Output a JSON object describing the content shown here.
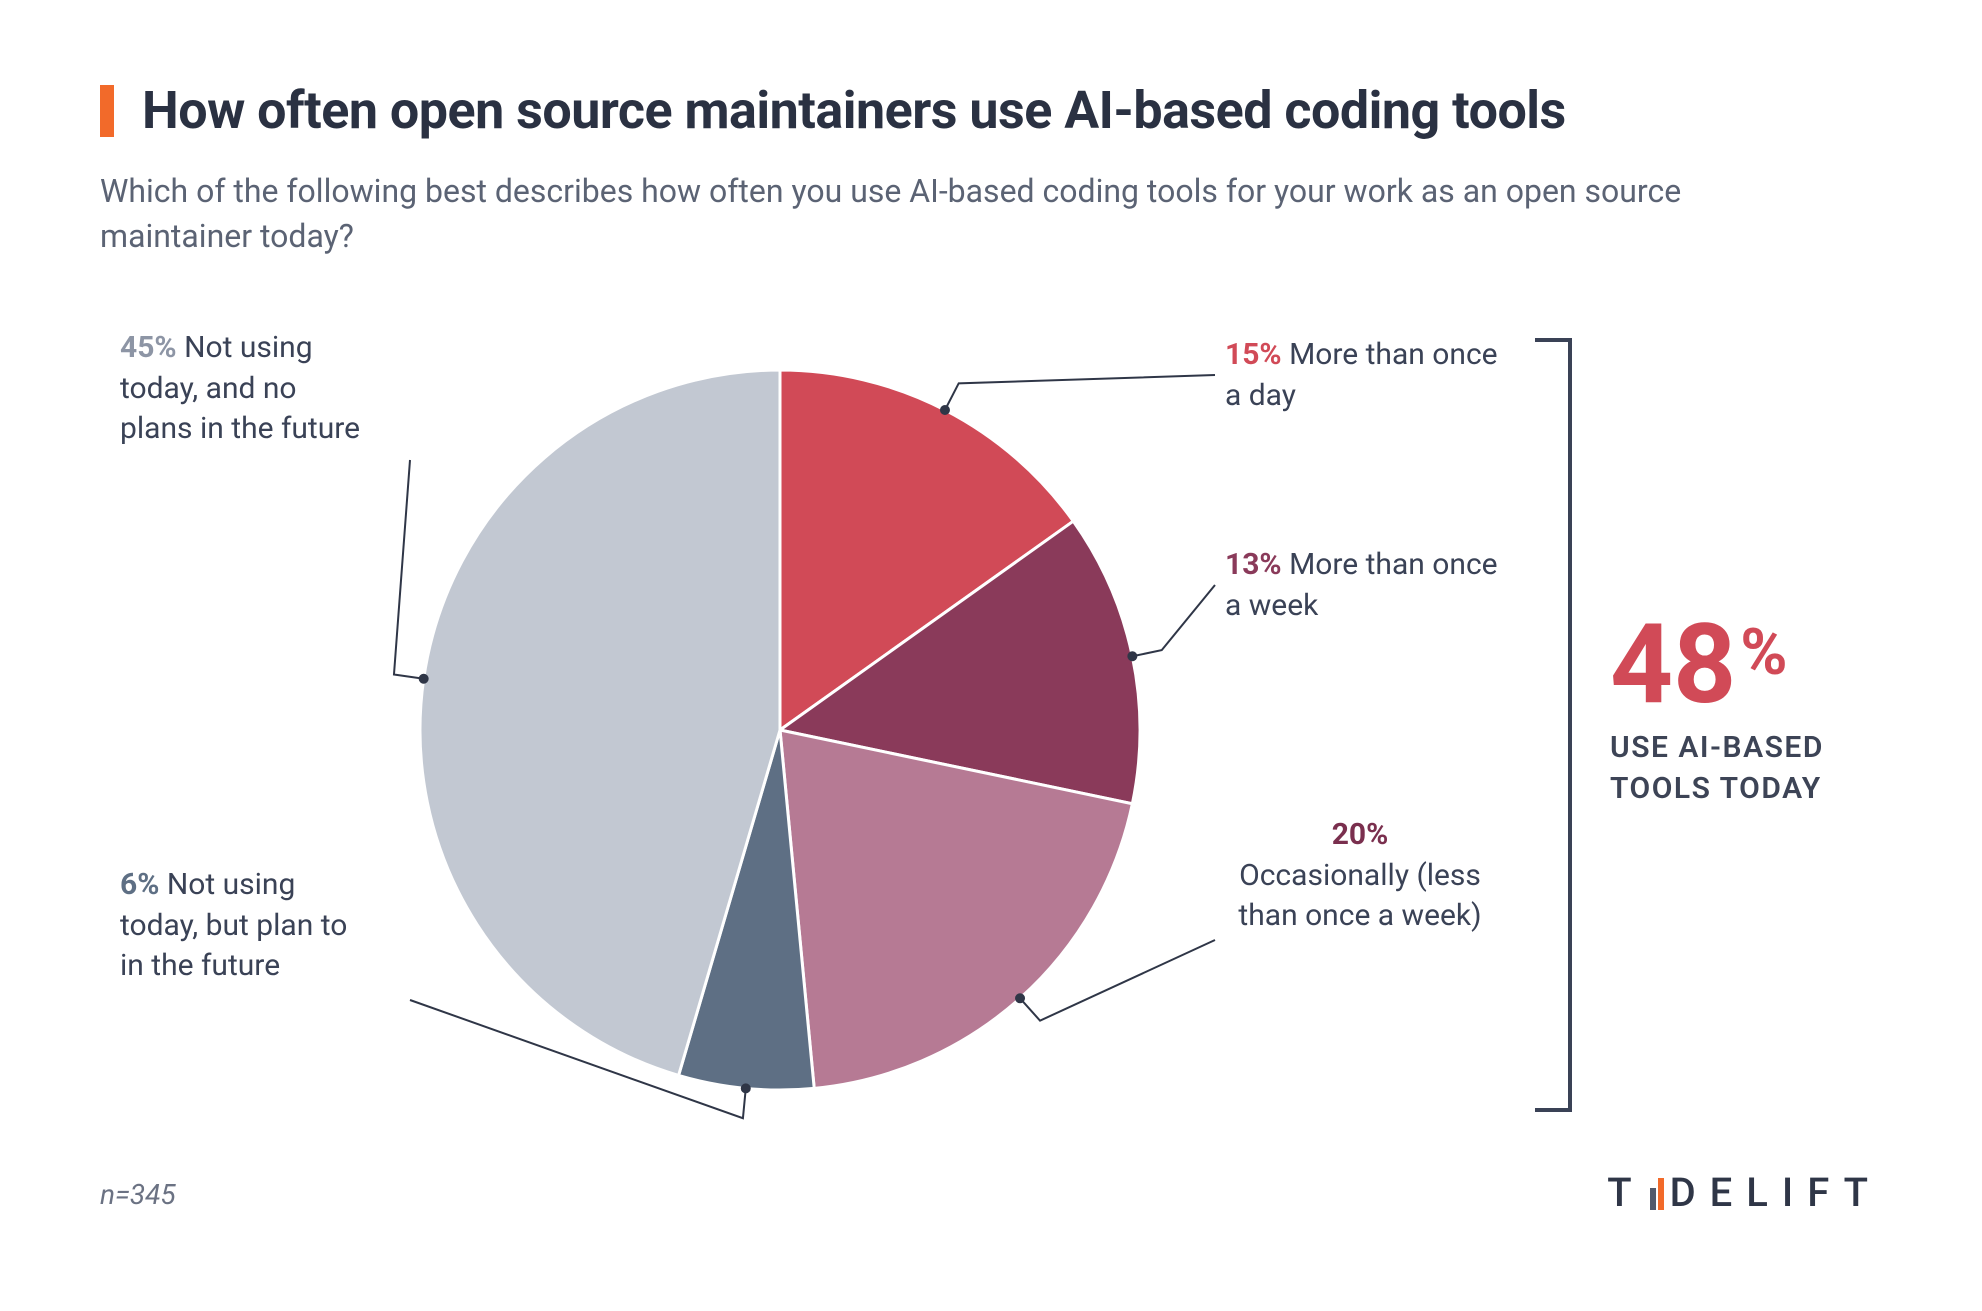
{
  "header": {
    "title": "How often open source maintainers use AI-based coding tools",
    "subtitle": "Which of the following best describes how often you use AI-based coding tools for your work as an open source maintainer today?"
  },
  "chart_data": {
    "type": "pie",
    "title": "How often open source maintainers use AI-based coding tools",
    "series": [
      {
        "name": "More than once a day",
        "value": 15,
        "pct_label": "15%",
        "color": "#d14a57"
      },
      {
        "name": "More than once a week",
        "value": 13,
        "pct_label": "13%",
        "color": "#8a3a5a"
      },
      {
        "name": "Occasionally (less than once a week)",
        "value": 20,
        "pct_label": "20%",
        "color": "#b67a94"
      },
      {
        "name": "Not using today, but plan to in the future",
        "value": 6,
        "pct_label": "6%",
        "color": "#5e6f84"
      },
      {
        "name": "Not using today, and no plans in the future",
        "value": 45,
        "pct_label": "45%",
        "color": "#c2c8d2"
      }
    ],
    "group_total": {
      "value": 48,
      "value_label": "48",
      "caption": "USE AI-BASED TOOLS TODAY",
      "includes_series": [
        "More than once a day",
        "More than once a week",
        "Occasionally (less than once a week)"
      ]
    },
    "n_label": "n=345",
    "n": 345
  },
  "labels": {
    "s0_pct": "15%",
    "s0_name": "More than once a day",
    "s1_pct": "13%",
    "s1_name": "More than once a week",
    "s2_pct": "20%",
    "s2_name_line1": "Occasionally (less",
    "s2_name_line2": "than once a week)",
    "s3_pct": "6%",
    "s3_name_line1": "Not using",
    "s3_name_line2": "today, but plan to",
    "s3_name_line3": "in the future",
    "s4_pct": "45%",
    "s4_name_line1": "Not using",
    "s4_name_line2": "today, and no",
    "s4_name_line3": "plans in the future"
  },
  "brand": {
    "name": "TIDELIFT",
    "pre": "T",
    "post": "DELIFT",
    "accent_color": "#f26a2a"
  }
}
